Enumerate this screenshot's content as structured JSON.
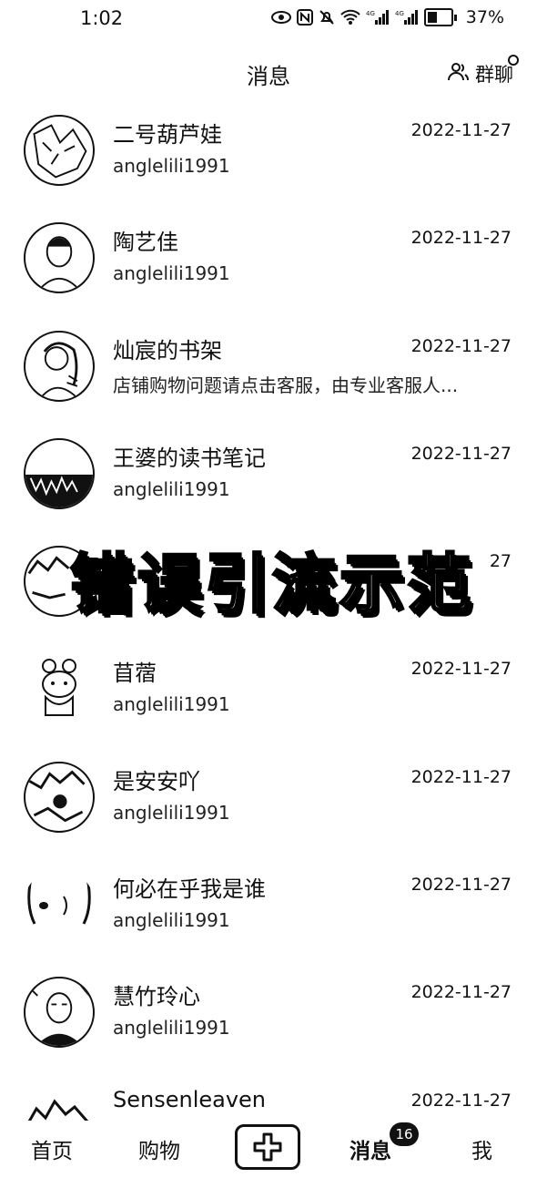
{
  "status_bar": {
    "time": "1:02",
    "battery_percent": "37%",
    "icons": [
      "eye-icon",
      "nfc-icon",
      "mute-icon",
      "wifi-icon",
      "signal-4g-icon",
      "signal-4g-icon",
      "battery-icon"
    ]
  },
  "header": {
    "title": "消息",
    "group_chat_label": "群聊"
  },
  "conversations": [
    {
      "name": "二号葫芦娃",
      "date": "2022-11-27",
      "preview": "anglelili1991"
    },
    {
      "name": "陶艺佳",
      "date": "2022-11-27",
      "preview": "anglelili1991"
    },
    {
      "name": "灿宸的书架",
      "date": "2022-11-27",
      "preview": "店铺购物问题请点击客服，由专业客服人..."
    },
    {
      "name": "王婆的读书笔记",
      "date": "2022-11-27",
      "preview": "anglelili1991"
    },
    {
      "name": "",
      "date": "27",
      "preview": ""
    },
    {
      "name": "苜蓿",
      "date": "2022-11-27",
      "preview": "anglelili1991"
    },
    {
      "name": "是安安吖",
      "date": "2022-11-27",
      "preview": "anglelili1991"
    },
    {
      "name": "何必在乎我是谁",
      "date": "2022-11-27",
      "preview": "anglelili1991"
    },
    {
      "name": "慧竹玲心",
      "date": "2022-11-27",
      "preview": "anglelili1991"
    },
    {
      "name": "Sensenleaven",
      "date": "2022-11-27",
      "preview": ""
    }
  ],
  "overlay_banner": "错误引流示范",
  "tabbar": {
    "home": "首页",
    "shop": "购物",
    "plus": "+",
    "messages": "消息",
    "messages_badge": "16",
    "me": "我"
  }
}
